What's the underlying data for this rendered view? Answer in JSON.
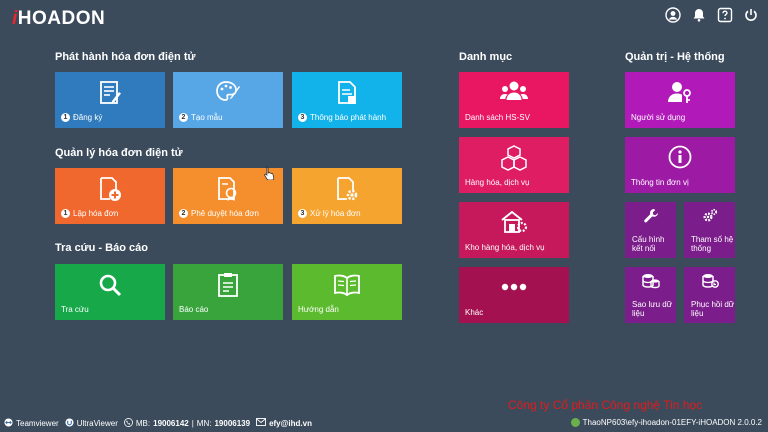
{
  "app": {
    "logo_prefix": "i",
    "logo_text": "HOADON"
  },
  "sections": {
    "issue": "Phát hành hóa đơn điện tử",
    "manage": "Quản lý hóa đơn điện tử",
    "lookup": "Tra cứu - Báo cáo",
    "catalog": "Danh mục",
    "admin": "Quản trị - Hệ thống"
  },
  "tiles": {
    "register": {
      "num": "1",
      "label": "Đăng ký"
    },
    "template": {
      "num": "2",
      "label": "Tạo mẫu"
    },
    "notice": {
      "num": "3",
      "label": "Thông báo phát hành"
    },
    "create_invoice": {
      "num": "1",
      "label": "Lập hóa đơn"
    },
    "approve_invoice": {
      "num": "2",
      "label": "Phê duyệt hóa đơn"
    },
    "process_invoice": {
      "num": "3",
      "label": "Xử lý hóa đơn"
    },
    "lookup": {
      "label": "Tra cứu"
    },
    "report": {
      "label": "Báo cáo"
    },
    "guide": {
      "label": "Hướng dẫn"
    },
    "students": {
      "label": "Danh sách HS-SV"
    },
    "goods": {
      "label": "Hàng hóa, dịch vụ"
    },
    "warehouse": {
      "label": "Kho hàng hóa, dịch vụ"
    },
    "other": {
      "label": "Khác"
    },
    "users": {
      "label": "Người sử dụng"
    },
    "unit_info": {
      "label": "Thông tin đơn vị"
    },
    "connection": {
      "label": "Cấu hình kết nối"
    },
    "params": {
      "label": "Tham số hệ thống"
    },
    "backup": {
      "label": "Sao lưu dữ liệu"
    },
    "restore": {
      "label": "Phục hồi dữ liệu"
    }
  },
  "status": {
    "teamviewer": "Teamviewer",
    "ultraviewer": "UltraViewer",
    "mb_label": "MB:",
    "mb_number": "19006142",
    "mn_label": "MN:",
    "mn_number": "19006139",
    "email": "efy@ihd.vn",
    "path": "ThaoNP603\\efy-ihoadon-01EFY-iHOADON 2.0.0.2",
    "company": "Công ty Cổ phần Công nghệ Tin học"
  },
  "icons": {
    "top": [
      "user-icon",
      "bell-icon",
      "help-icon",
      "power-icon"
    ]
  },
  "colors": {
    "background": "#3b4b5c",
    "logo_accent": "#e8262b",
    "company_text": "#e21b1b"
  }
}
